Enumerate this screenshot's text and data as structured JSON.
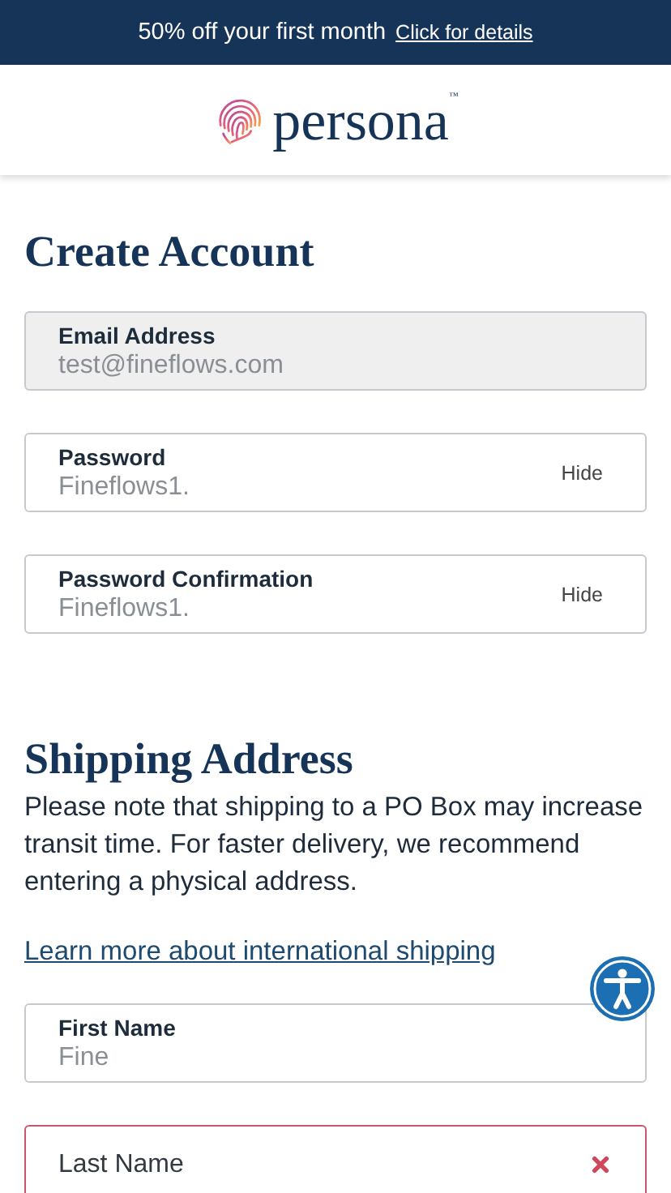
{
  "banner": {
    "text": "50% off your first month",
    "link": "Click for details"
  },
  "header": {
    "logo": "persona$^{™}$"
  },
  "account": {
    "title": "Create Account",
    "fields": [
      {
        "label": "Email Address",
        "value": "test@fineflows.com",
        "disabled": true,
        "error": false
      },
      {
        "label": "Password",
        "value": "Fineflows1.",
        "toggle": "Hide",
        "disabled": false,
        "error": false
      },
      {
        "label": "Password Confirmation",
        "value": "Fineflows1.",
        "toggle": "Hide",
        "disabled": false,
        "error": false
      }
    ]
  },
  "shipping": {
    "title": "Shipping Address",
    "note": "Please note that shipping to a PO Box may increase transit time. For faster delivery, we recommend entering a physical address.",
    "link": "Learn more about international shipping",
    "fields": [
      {
        "label": "First Name",
        "value": "Fine",
        "disabled": false,
        "error": false
      },
      {
        "label": "Last Name",
        "disabled": false,
        "error": true
      }
    ]
  }
}
